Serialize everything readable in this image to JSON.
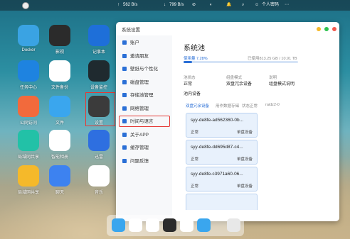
{
  "topbar": {
    "upload_speed": "562 B/s",
    "download_speed": "799 B/s",
    "username": "个人密码",
    "icons": [
      "nas-logo-icon",
      "upload-arrow-icon",
      "download-arrow-icon",
      "blocked-icon",
      "brightness-icon",
      "bell-icon",
      "search-icon",
      "user-icon",
      "more-icon"
    ]
  },
  "desktop": {
    "apps": [
      {
        "label": "Docker",
        "icon": "docker-icon",
        "color": "#3aa3e3"
      },
      {
        "label": "影视",
        "icon": "clapper-icon",
        "color": "#2b2b2b"
      },
      {
        "label": "记事本",
        "icon": "notepad-icon",
        "color": "#1e6fd9"
      },
      {
        "label": "任务中心",
        "icon": "task-icon",
        "color": "#1e83e0"
      },
      {
        "label": "文件备份",
        "icon": "cloud-backup-icon",
        "color": "#ffffff"
      },
      {
        "label": "设备监控",
        "icon": "monitor-icon",
        "color": "#1f2a2f"
      },
      {
        "label": "公网访问",
        "icon": "public-access-icon",
        "color": "#f26a3c"
      },
      {
        "label": "文件",
        "icon": "folder-icon",
        "color": "#3aa6ee"
      },
      {
        "label": "设置",
        "icon": "gear-icon",
        "color": "#3b3b3b"
      },
      {
        "label": "局域网共享",
        "icon": "lan-share-icon",
        "color": "#22c1a7"
      },
      {
        "label": "智能相册",
        "icon": "photos-icon",
        "color": "#ffffff"
      },
      {
        "label": "迅雷",
        "icon": "xunlei-icon",
        "color": "#2e6fe0"
      },
      {
        "label": "局域网共享",
        "icon": "lan-folder-icon",
        "color": "#f5b92a"
      },
      {
        "label": "聊天",
        "icon": "chat-icon",
        "color": "#3d82f0"
      },
      {
        "label": "音乐",
        "icon": "music-icon",
        "color": "#ffffff"
      }
    ],
    "annotation": "2"
  },
  "window": {
    "title": "系统设置",
    "sidebar": [
      {
        "label": "账户",
        "icon": "account-icon"
      },
      {
        "label": "邀请朋友",
        "icon": "share-icon"
      },
      {
        "label": "壁纸与个性化",
        "icon": "wallpaper-icon"
      },
      {
        "label": "磁盘管理",
        "icon": "disk-icon"
      },
      {
        "label": "存储池管理",
        "icon": "storage-pool-icon",
        "active": true
      },
      {
        "label": "网络管理",
        "icon": "network-icon"
      },
      {
        "label": "时间与语言",
        "icon": "clock-icon"
      },
      {
        "label": "关于APP",
        "icon": "info-icon"
      },
      {
        "label": "缓存管理",
        "icon": "cache-icon"
      },
      {
        "label": "问题反馈",
        "icon": "feedback-icon"
      }
    ],
    "pool": {
      "heading": "系统池",
      "used_label": "使用量 7.28%",
      "used_fraction": 0.0728,
      "capacity_label": "已使用813.25 GB / 10.91 TB",
      "status_label": "池状态",
      "status_value": "正常",
      "mode_label": "组盘模式",
      "mode_value": "双盘冗余设备",
      "desc_label": "说明",
      "desc_value": "组盘模式说明",
      "inner_label": "池内设备",
      "filters": [
        "双盘冗余设备",
        "用作数据存储",
        "状态正常",
        "raidz2-0"
      ],
      "devices": [
        {
          "name": "syy-de8fe-ad562360-0b...",
          "status": "正常",
          "type": "单盘设备"
        },
        {
          "name": "syy-de8fe-dd695d87-c4...",
          "status": "正常",
          "type": "单盘设备"
        },
        {
          "name": "syy-de8fe-c3971a60-06...",
          "status": "正常",
          "type": "单盘设备"
        }
      ]
    }
  },
  "dock": {
    "items": [
      "files-dock-icon",
      "photos-dock-icon",
      "music-dock-icon",
      "video-dock-icon",
      "album-dock-icon",
      "folder-dock-icon",
      "settings-dock-icon"
    ]
  }
}
